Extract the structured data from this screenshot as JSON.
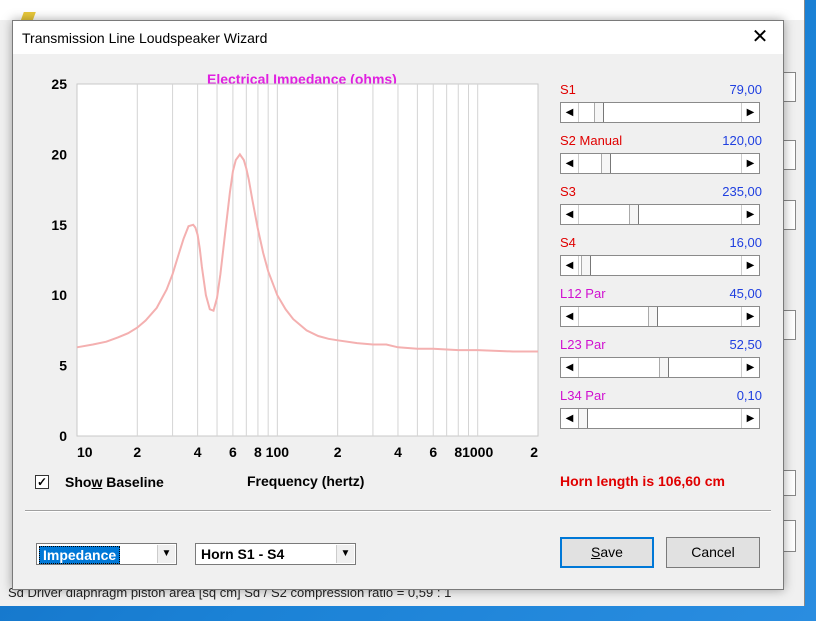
{
  "background_window": {
    "status_text": "Sd   Driver diaphragm piston area  [sq cm]   Sd / S2 compression ratio = 0,59 : 1"
  },
  "dialog": {
    "title": "Transmission Line Loudspeaker Wizard",
    "close_glyph": "✕"
  },
  "chart_data": {
    "type": "line",
    "title": "Electrical Impedance (ohms)",
    "xlabel": "Frequency (hertz)",
    "ylabel": "",
    "x_scale": "log",
    "xlim": [
      10,
      2000
    ],
    "ylim": [
      0,
      25
    ],
    "y_ticks": [
      "0",
      "5",
      "10",
      "15",
      "20",
      "25"
    ],
    "x_ticks": [
      {
        "value": 10,
        "label": "10"
      },
      {
        "value": 20,
        "label": "2"
      },
      {
        "value": 40,
        "label": "4"
      },
      {
        "value": 60,
        "label": "6"
      },
      {
        "value": 80,
        "label": "8"
      },
      {
        "value": 100,
        "label": "100"
      },
      {
        "value": 200,
        "label": "2"
      },
      {
        "value": 400,
        "label": "4"
      },
      {
        "value": 600,
        "label": "6"
      },
      {
        "value": 800,
        "label": "8"
      },
      {
        "value": 1000,
        "label": "1000"
      },
      {
        "value": 2000,
        "label": "2"
      }
    ],
    "grid": true,
    "series_color": "#f4b0b0",
    "series": [
      {
        "x": [
          10,
          12,
          14,
          16,
          18,
          20,
          22,
          25,
          28,
          30,
          32,
          34,
          36,
          38,
          39,
          40,
          41,
          42,
          44,
          46,
          48,
          50,
          52,
          55,
          58,
          60,
          62,
          65,
          68,
          70,
          72,
          75,
          80,
          85,
          90,
          100,
          110,
          120,
          140,
          160,
          180,
          200,
          250,
          300,
          350,
          400,
          500,
          600,
          800,
          1000,
          1500,
          2000
        ],
        "y": [
          6.3,
          6.5,
          6.7,
          7.0,
          7.3,
          7.7,
          8.2,
          9.1,
          10.4,
          11.5,
          12.8,
          14.0,
          14.9,
          15.0,
          14.8,
          14.3,
          13.3,
          12.0,
          10.0,
          9.0,
          8.9,
          9.8,
          11.5,
          14.5,
          17.3,
          18.8,
          19.6,
          20.0,
          19.6,
          19.0,
          18.2,
          16.8,
          14.7,
          13.0,
          11.7,
          10.0,
          9.0,
          8.3,
          7.5,
          7.1,
          6.9,
          6.8,
          6.6,
          6.5,
          6.5,
          6.3,
          6.2,
          6.2,
          6.1,
          6.1,
          6.0,
          6.0
        ]
      }
    ]
  },
  "controls": {
    "show_baseline": {
      "label_pre": "Sho",
      "label_u": "w",
      "label_post": " Baseline",
      "checked_glyph": "✓"
    },
    "horn_length": "Horn length is 106,60 cm"
  },
  "sliders": [
    {
      "label": "S1",
      "value": "79,00",
      "kind": "normal",
      "thumb_fraction": 0.1
    },
    {
      "label": "S2  Manual",
      "value": "120,00",
      "kind": "normal",
      "thumb_fraction": 0.15
    },
    {
      "label": "S3",
      "value": "235,00",
      "kind": "normal",
      "thumb_fraction": 0.33
    },
    {
      "label": "S4",
      "value": "16,00",
      "kind": "normal",
      "thumb_fraction": 0.02
    },
    {
      "label": "L12  Par",
      "value": "45,00",
      "kind": "par",
      "thumb_fraction": 0.45
    },
    {
      "label": "L23  Par",
      "value": "52,50",
      "kind": "par",
      "thumb_fraction": 0.52
    },
    {
      "label": "L34  Par",
      "value": "0,10",
      "kind": "par",
      "thumb_fraction": 0.0
    }
  ],
  "slider_arrows": {
    "left": "◀",
    "right": "▶"
  },
  "dropdowns": {
    "graph_type": {
      "selected": "Impedance"
    },
    "horn_section": {
      "selected": "Horn S1 - S4"
    },
    "arrow_glyph": "▼"
  },
  "buttons": {
    "save": {
      "pre": "",
      "u": "S",
      "post": "ave"
    },
    "cancel": "Cancel"
  }
}
